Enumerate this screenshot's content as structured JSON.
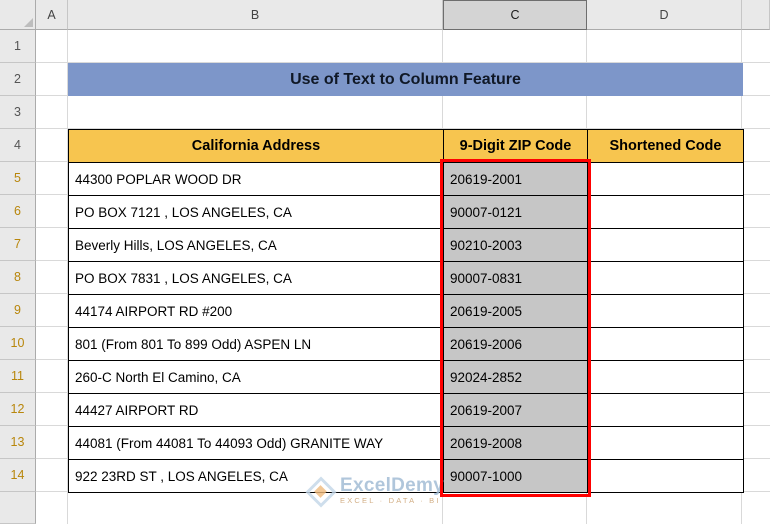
{
  "column_letters": [
    "A",
    "B",
    "C",
    "D"
  ],
  "row_numbers": [
    "1",
    "2",
    "3",
    "4",
    "5",
    "6",
    "7",
    "8",
    "9",
    "10",
    "11",
    "12",
    "13",
    "14"
  ],
  "selected_column": "C",
  "banner": {
    "title": "Use of Text to Column Feature"
  },
  "table": {
    "headers": [
      "California Address",
      "9-Digit ZIP Code",
      "Shortened Code"
    ],
    "rows": [
      {
        "address": "44300 POPLAR WOOD DR",
        "zip": "20619-2001",
        "short": ""
      },
      {
        "address": "PO BOX 7121 , LOS ANGELES, CA",
        "zip": "90007-0121",
        "short": ""
      },
      {
        "address": "Beverly Hills,  LOS ANGELES, CA",
        "zip": "90210-2003",
        "short": ""
      },
      {
        "address": "PO BOX 7831 , LOS ANGELES, CA",
        "zip": "90007-0831",
        "short": ""
      },
      {
        "address": "44174 AIRPORT RD #200",
        "zip": "20619-2005",
        "short": ""
      },
      {
        "address": "801 (From 801 To 899 Odd) ASPEN LN",
        "zip": "20619-2006",
        "short": ""
      },
      {
        "address": "260-C North El Camino, CA",
        "zip": "92024-2852",
        "short": ""
      },
      {
        "address": "44427 AIRPORT RD",
        "zip": "20619-2007",
        "short": ""
      },
      {
        "address": "44081 (From 44081 To 44093 Odd) GRANITE WAY",
        "zip": "20619-2008",
        "short": ""
      },
      {
        "address": "922 23RD ST , LOS ANGELES, CA",
        "zip": "90007-1000",
        "short": ""
      }
    ]
  },
  "colors": {
    "banner_bg": "#7d96c9",
    "table_header_bg": "#f7c54f",
    "selected_cells_fill": "#c6c6c6",
    "selection_border": "#ff0000",
    "selected_row_number": "#b8860b"
  },
  "watermark": {
    "brand": "ExcelDemy",
    "tagline": "EXCEL · DATA · BI"
  }
}
